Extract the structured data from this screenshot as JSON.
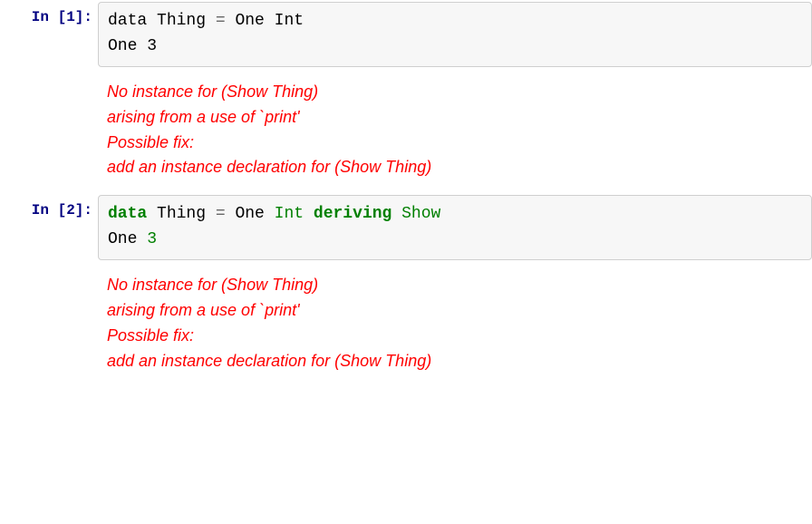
{
  "cells": [
    {
      "prompt": "In [1]:",
      "code": {
        "line1": {
          "tokens": [
            {
              "text": "data",
              "class": "plain"
            },
            {
              "text": " Thing ",
              "class": "plain"
            },
            {
              "text": "=",
              "class": "op"
            },
            {
              "text": " One ",
              "class": "plain"
            },
            {
              "text": "Int",
              "class": "plain"
            }
          ]
        },
        "line2": {
          "tokens": [
            {
              "text": "One ",
              "class": "plain"
            },
            {
              "text": "3",
              "class": "plain"
            }
          ]
        }
      },
      "error": [
        "No instance for (Show Thing)",
        "arising from a use of `print'",
        "Possible fix:",
        "add an instance declaration for (Show Thing)"
      ]
    },
    {
      "prompt": "In [2]:",
      "code": {
        "line1": {
          "tokens": [
            {
              "text": "data",
              "class": "kw"
            },
            {
              "text": " Thing ",
              "class": "plain"
            },
            {
              "text": "=",
              "class": "op"
            },
            {
              "text": " One ",
              "class": "plain"
            },
            {
              "text": "Int",
              "class": "type"
            },
            {
              "text": " ",
              "class": "plain"
            },
            {
              "text": "deriving",
              "class": "kw"
            },
            {
              "text": " ",
              "class": "plain"
            },
            {
              "text": "Show",
              "class": "type"
            }
          ]
        },
        "line2": {
          "tokens": [
            {
              "text": "One ",
              "class": "plain"
            },
            {
              "text": "3",
              "class": "num"
            }
          ]
        }
      },
      "error": [
        "No instance for (Show Thing)",
        "arising from a use of `print'",
        "Possible fix:",
        "add an instance declaration for (Show Thing)"
      ]
    }
  ]
}
